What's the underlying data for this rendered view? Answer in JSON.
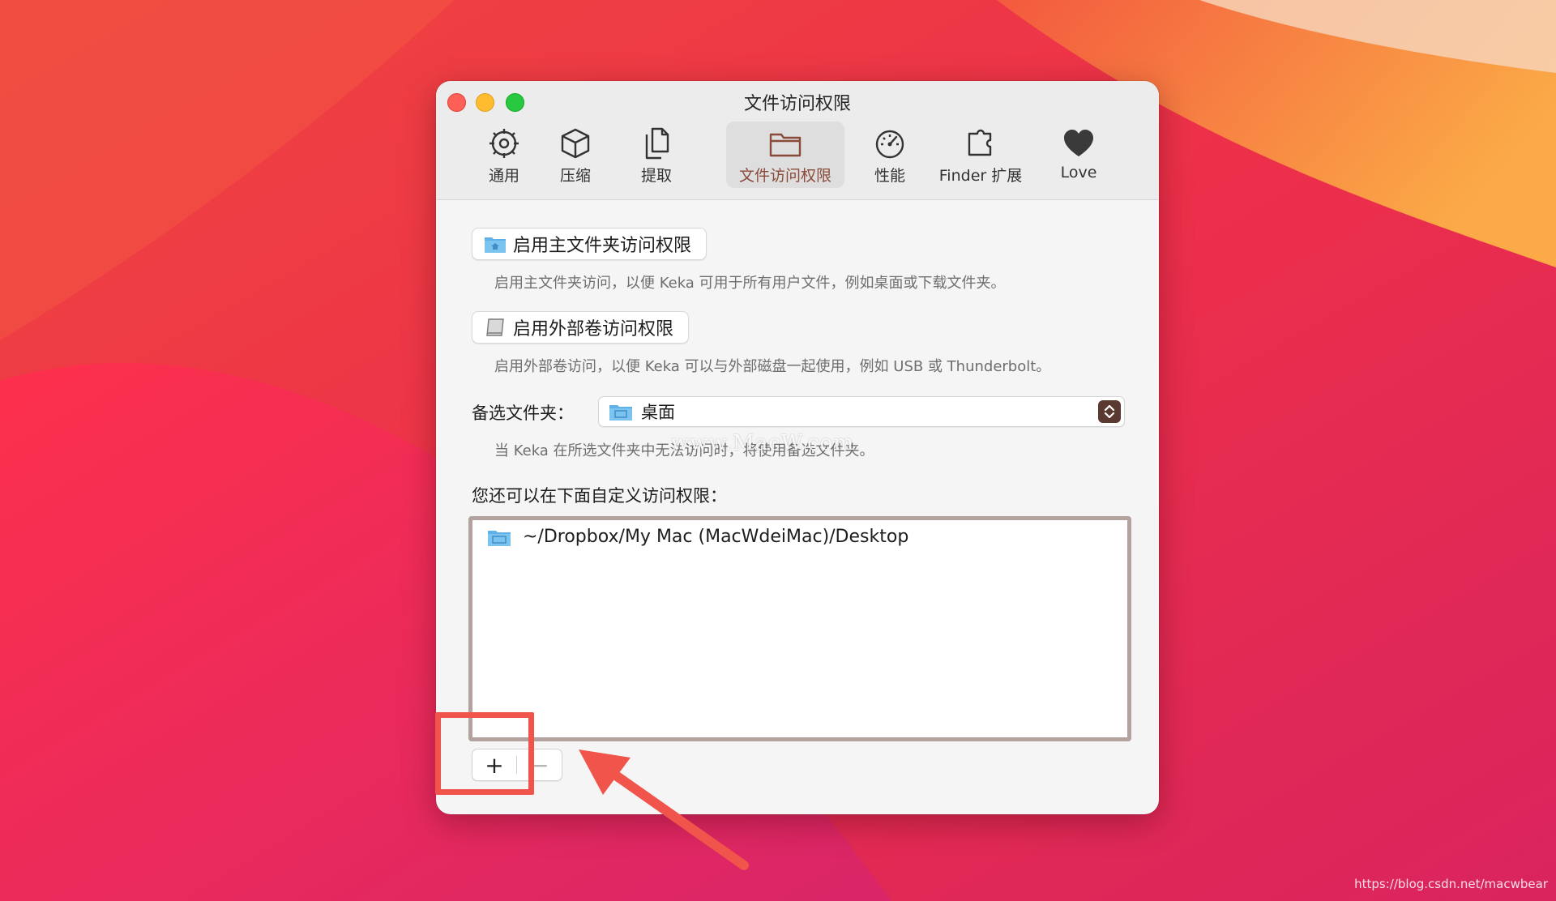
{
  "window": {
    "title": "文件访问权限"
  },
  "toolbar": {
    "items": [
      {
        "label": "通用",
        "icon": "gear-icon"
      },
      {
        "label": "压缩",
        "icon": "box-icon"
      },
      {
        "label": "提取",
        "icon": "document-icon"
      },
      {
        "label": "文件访问权限",
        "icon": "folder-icon",
        "active": true
      },
      {
        "label": "性能",
        "icon": "gauge-icon"
      },
      {
        "label": "Finder 扩展",
        "icon": "puzzle-icon"
      },
      {
        "label": "Love",
        "icon": "heart-icon"
      }
    ]
  },
  "home_access": {
    "button_label": "启用主文件夹访问权限",
    "hint": "启用主文件夹访问，以便 Keka 可用于所有用户文件，例如桌面或下载文件夹。"
  },
  "external_access": {
    "button_label": "启用外部卷访问权限",
    "hint": "启用外部卷访问，以便 Keka 可以与外部磁盘一起使用，例如 USB 或 Thunderbolt。"
  },
  "fallback": {
    "label": "备选文件夹：",
    "selected": "桌面",
    "hint": "当 Keka 在所选文件夹中无法访问时，将使用备选文件夹。"
  },
  "custom": {
    "label": "您还可以在下面自定义访问权限：",
    "paths": [
      "~/Dropbox/My Mac (MacWdeiMac)/Desktop"
    ]
  },
  "controls": {
    "add": "+",
    "remove": "−"
  },
  "watermark": "www.MacW.com",
  "credit": "https://blog.csdn.net/macwbear",
  "colors": {
    "accent": "#8a4a3a",
    "highlight": "#f0544a",
    "list_border": "#b3a29e"
  }
}
